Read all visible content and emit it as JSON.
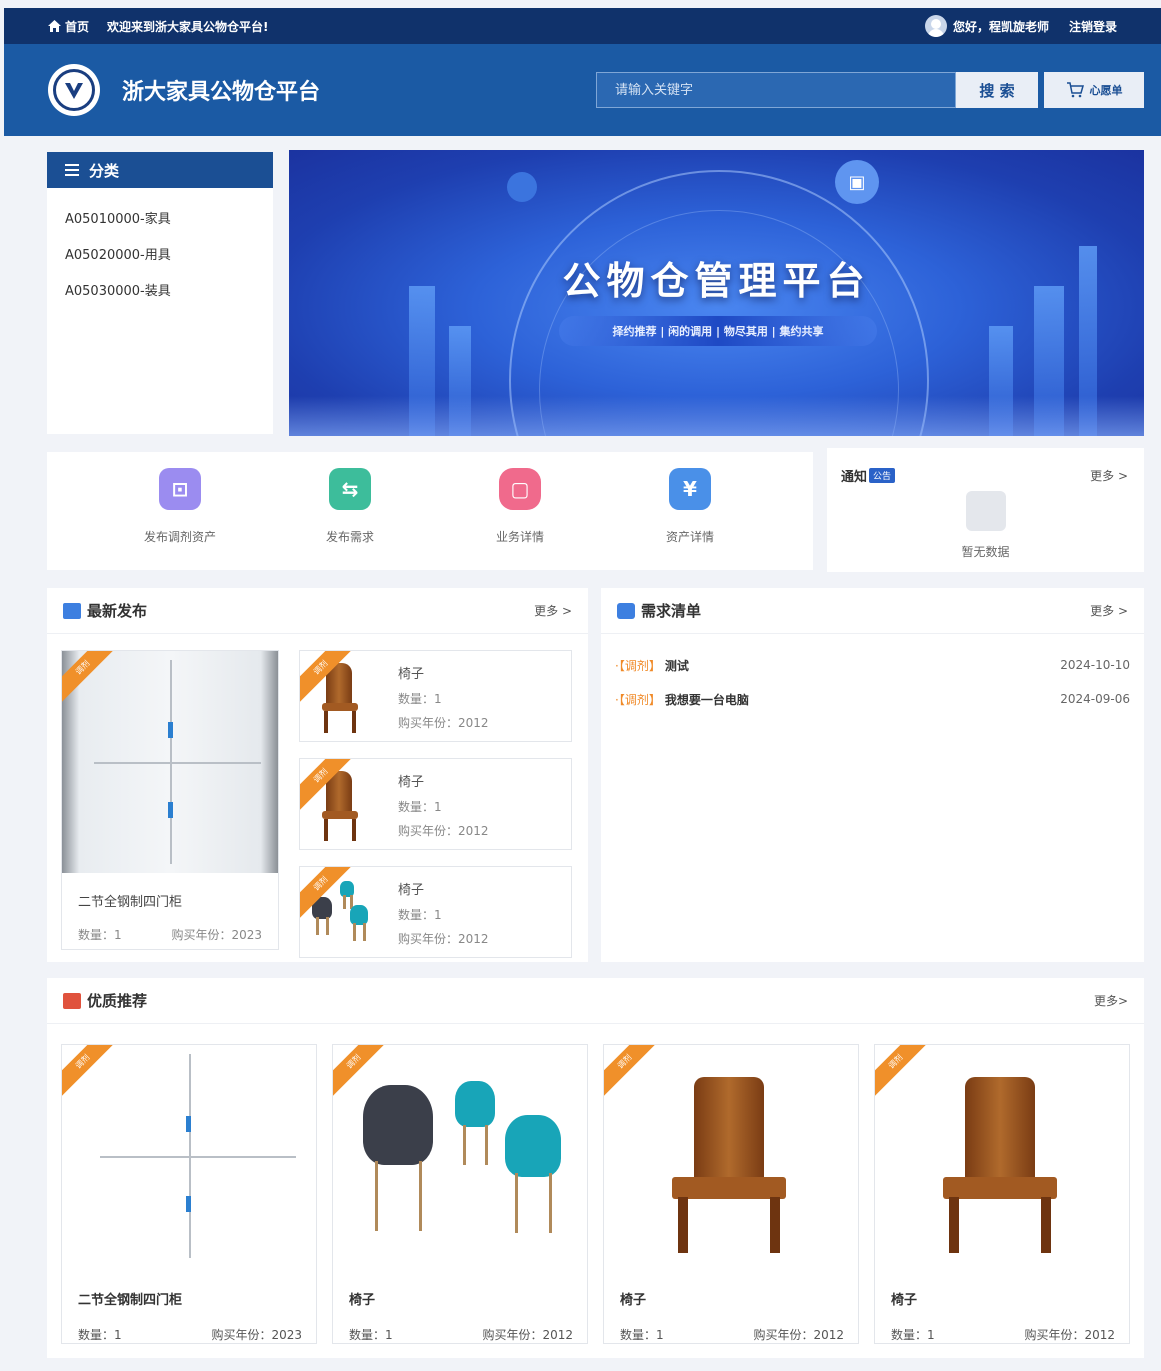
{
  "topbar": {
    "home_label": "首页",
    "welcome": "欢迎来到浙大家具公物仓平台!",
    "greeting": "您好，程凯旋老师",
    "logout": "注销登录"
  },
  "header": {
    "site_title": "浙大家具公物仓平台",
    "search_placeholder": "请输入关键字",
    "search_button": "搜 索",
    "cart_button": "心愿单"
  },
  "categories": {
    "title": "分类",
    "items": [
      "A05010000-家具",
      "A05020000-用具",
      "A05030000-装具"
    ]
  },
  "banner": {
    "title": "公物仓管理平台",
    "subtitle": "择约推荐 | 闲的调用 | 物尽其用 | 集约共享"
  },
  "quick_actions": [
    {
      "label": "发布调剂资产",
      "color": "#9b8cf0",
      "icon": "briefcase-icon"
    },
    {
      "label": "发布需求",
      "color": "#3dbd9b",
      "icon": "exchange-icon"
    },
    {
      "label": "业务详情",
      "color": "#f06a8c",
      "icon": "bag-icon"
    },
    {
      "label": "资产详情",
      "color": "#4a90e8",
      "icon": "monitor-yuan-icon"
    }
  ],
  "notice": {
    "title": "通知",
    "tag": "公告",
    "more": "更多 >",
    "empty": "暂无数据"
  },
  "latest": {
    "title": "最新发布",
    "more": "更多 >",
    "featured": {
      "name": "二节全钢制四门柜",
      "qty": "数量：1",
      "year": "购买年份：2023",
      "badge": "调剂"
    },
    "items": [
      {
        "name": "椅子",
        "qty": "数量：1",
        "year": "购买年份：2012",
        "badge": "调剂"
      },
      {
        "name": "椅子",
        "qty": "数量：1",
        "year": "购买年份：2012",
        "badge": "调剂"
      },
      {
        "name": "椅子",
        "qty": "数量：1",
        "year": "购买年份：2012",
        "badge": "调剂"
      }
    ]
  },
  "demand": {
    "title": "需求清单",
    "more": "更多 >",
    "items": [
      {
        "tag": "·【调剂】",
        "text": "测试",
        "date": "2024-10-10"
      },
      {
        "tag": "·【调剂】",
        "text": "我想要一台电脑",
        "date": "2024-09-06"
      }
    ]
  },
  "recommend": {
    "title": "优质推荐",
    "more": "更多>",
    "items": [
      {
        "name": "二节全钢制四门柜",
        "qty": "数量：1",
        "year": "购买年份：2023",
        "badge": "调剂"
      },
      {
        "name": "椅子",
        "qty": "数量：1",
        "year": "购买年份：2012",
        "badge": "调剂"
      },
      {
        "name": "椅子",
        "qty": "数量：1",
        "year": "购买年份：2012",
        "badge": "调剂"
      },
      {
        "name": "椅子",
        "qty": "数量：1",
        "year": "购买年份：2012",
        "badge": "调剂"
      }
    ]
  },
  "colors": {
    "primary": "#1b5aa4",
    "topbar": "#10326b",
    "accent_orange": "#f0902a"
  }
}
